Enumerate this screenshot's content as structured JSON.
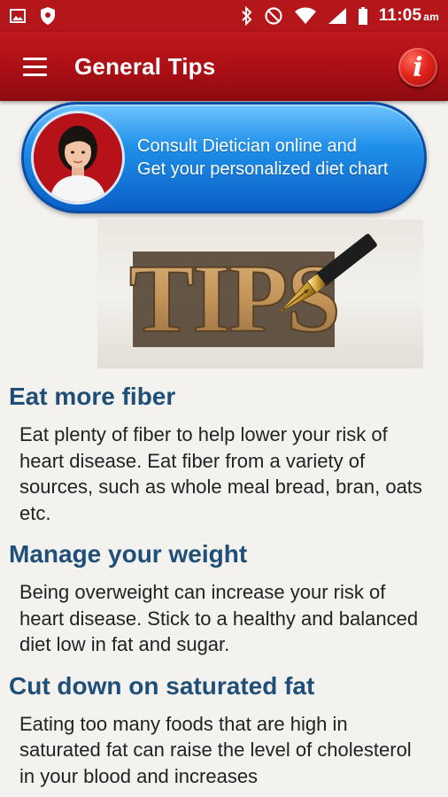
{
  "status_bar": {
    "time": "11:05",
    "ampm": "am",
    "left_icons": [
      "image-icon",
      "shield-icon"
    ],
    "right_icons": [
      "bluetooth-icon",
      "do-not-disturb-icon",
      "wifi-icon",
      "signal-icon",
      "battery-icon"
    ]
  },
  "app_bar": {
    "title": "General Tips",
    "menu_icon": "hamburger-menu-icon",
    "info_icon": "info-icon",
    "info_glyph": "i"
  },
  "consult_banner": {
    "line1": "Consult Dietician online and",
    "line2": "Get your personalized diet chart"
  },
  "tips_image": {
    "text": "TIPS",
    "icon": "fountain-pen-icon"
  },
  "sections": [
    {
      "title": "Eat more fiber",
      "body": "Eat plenty of fiber to help lower your risk of heart disease. Eat fiber from a variety of sources, such as whole meal bread, bran, oats etc."
    },
    {
      "title": "Manage your weight",
      "body": "Being overweight can increase your risk of heart disease. Stick to a healthy and balanced diet low in fat and sugar."
    },
    {
      "title": "Cut down on saturated fat",
      "body": "Eating too many foods that are high in saturated fat can raise the level of cholesterol in your blood and increases"
    }
  ],
  "colors": {
    "status_bar": "#b4161a",
    "app_bar": "#a80f14",
    "section_title": "#1f4f78",
    "banner_blue": "#1f8fe8"
  }
}
